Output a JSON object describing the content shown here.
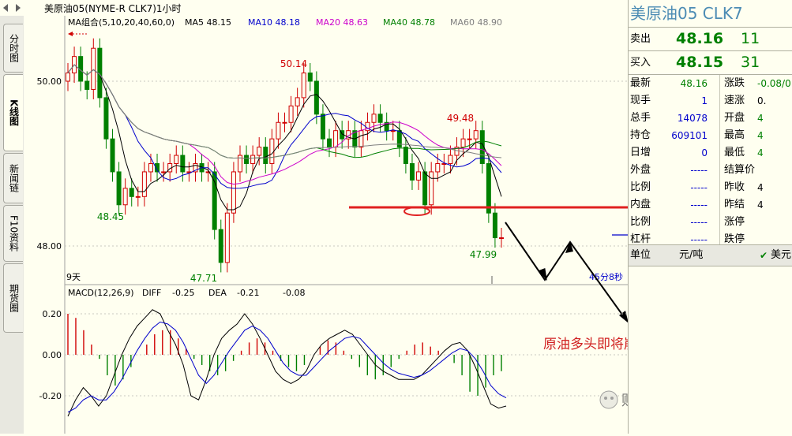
{
  "window": {
    "title": "美原油05(NYME-R CLK7)1小时"
  },
  "side_tabs": [
    {
      "label": "分时图"
    },
    {
      "label": "K线图"
    },
    {
      "label": "新闻链"
    },
    {
      "label": "F10资料"
    },
    {
      "label": "期货圈"
    }
  ],
  "ma_legend": {
    "group": "MA组合(5,10,20,40,60,0)",
    "items": [
      {
        "label": "MA5 48.15",
        "color": "#000000"
      },
      {
        "label": "MA10 48.18",
        "color": "#0000cc"
      },
      {
        "label": "MA20 48.63",
        "color": "#cc00cc"
      },
      {
        "label": "MA40 48.78",
        "color": "#008000"
      },
      {
        "label": "MA60 48.90",
        "color": "#808080"
      }
    ]
  },
  "price_annotations": {
    "high1": "50.14",
    "high2": "49.48",
    "low1": "48.45",
    "low2": "47.71",
    "low3": "47.99"
  },
  "time_labels": {
    "left": "9天",
    "right": "45分8秒"
  },
  "macd_legend": {
    "name": "MACD(12,26,9)",
    "diff_label": "DIFF",
    "diff": "-0.25",
    "dea_label": "DEA",
    "dea": "-0.21",
    "macd": "-0.08"
  },
  "annotation_text": "原油多头即将崩溃",
  "watermark": "财经生活参考",
  "colors": {
    "up": "#d00000",
    "down": "#008000",
    "bg": "#fffff0",
    "support_line": "#e02020"
  },
  "chart_data": [
    {
      "type": "candlestick",
      "title": "美原油05(NYME-R CLK7)1小时",
      "ylim": [
        47.5,
        50.5
      ],
      "y_ticks": [
        48.0,
        50.0
      ],
      "y_tick_labels": [
        "48.00",
        "50.00"
      ],
      "close": [
        50.1,
        50.3,
        50.0,
        49.9,
        50.4,
        49.8,
        49.3,
        48.9,
        48.5,
        48.7,
        48.6,
        48.6,
        48.9,
        49.0,
        48.9,
        48.9,
        49.0,
        49.1,
        48.9,
        48.9,
        49.0,
        48.9,
        48.9,
        48.2,
        47.8,
        48.4,
        48.9,
        49.1,
        49.0,
        49.1,
        49.2,
        49.0,
        49.3,
        49.5,
        49.5,
        49.7,
        49.8,
        50.1,
        50.0,
        49.6,
        49.3,
        49.2,
        49.4,
        49.3,
        49.4,
        49.2,
        49.4,
        49.5,
        49.6,
        49.5,
        49.4,
        49.4,
        49.2,
        49.0,
        48.8,
        48.9,
        48.5,
        48.9,
        49.0,
        49.0,
        49.1,
        49.2,
        49.3,
        49.3,
        49.4,
        49.0,
        48.4,
        48.1,
        48.1
      ],
      "support_level": 48.5,
      "annotations": [
        "50.14",
        "49.48",
        "48.45",
        "47.71",
        "47.99"
      ]
    },
    {
      "type": "bar+line",
      "name": "MACD(12,26,9)",
      "ylim": [
        -0.27,
        0.27
      ],
      "y_ticks": [
        0.2,
        0.0,
        -0.2
      ],
      "y_tick_labels": [
        "0.20",
        "0.00",
        "-0.20"
      ],
      "macd": [
        0.2,
        0.18,
        0.12,
        0.05,
        -0.02,
        -0.1,
        -0.15,
        -0.12,
        -0.06,
        0.0,
        0.05,
        0.1,
        0.12,
        0.12,
        0.08,
        0.03,
        -0.02,
        -0.05,
        -0.08,
        -0.1,
        -0.08,
        -0.03,
        0.02,
        0.06,
        0.08,
        0.06,
        0.02,
        -0.03,
        -0.06,
        -0.08,
        -0.05,
        0.0,
        0.04,
        0.07,
        0.06,
        0.02,
        -0.02,
        -0.06,
        -0.1,
        -0.12,
        -0.1,
        -0.06,
        -0.02,
        0.02,
        0.05,
        0.06,
        0.04,
        0.02,
        0.0,
        -0.04,
        -0.1,
        -0.18,
        -0.2,
        -0.16,
        -0.1,
        -0.08
      ],
      "diff": [
        -0.3,
        -0.22,
        -0.16,
        -0.2,
        -0.25,
        -0.2,
        -0.1,
        0.0,
        0.08,
        0.14,
        0.18,
        0.22,
        0.2,
        0.12,
        0.05,
        -0.05,
        -0.2,
        -0.22,
        -0.12,
        0.0,
        0.08,
        0.12,
        0.15,
        0.2,
        0.15,
        0.08,
        0.0,
        -0.08,
        -0.12,
        -0.14,
        -0.12,
        -0.08,
        0.0,
        0.05,
        0.08,
        0.1,
        0.12,
        0.1,
        0.05,
        0.0,
        -0.05,
        -0.08,
        -0.1,
        -0.12,
        -0.12,
        -0.12,
        -0.1,
        -0.06,
        -0.02,
        0.02,
        0.05,
        0.06,
        0.02,
        -0.06,
        -0.15,
        -0.24,
        -0.26,
        -0.25
      ],
      "dea": [
        -0.28,
        -0.26,
        -0.22,
        -0.2,
        -0.22,
        -0.22,
        -0.18,
        -0.12,
        -0.05,
        0.02,
        0.08,
        0.13,
        0.16,
        0.15,
        0.12,
        0.06,
        -0.02,
        -0.1,
        -0.14,
        -0.1,
        -0.04,
        0.02,
        0.07,
        0.12,
        0.14,
        0.12,
        0.08,
        0.02,
        -0.04,
        -0.08,
        -0.1,
        -0.1,
        -0.06,
        -0.02,
        0.02,
        0.05,
        0.08,
        0.09,
        0.08,
        0.04,
        0.0,
        -0.04,
        -0.07,
        -0.09,
        -0.1,
        -0.11,
        -0.1,
        -0.08,
        -0.05,
        -0.02,
        0.01,
        0.03,
        0.02,
        -0.02,
        -0.08,
        -0.15,
        -0.19,
        -0.21
      ]
    }
  ],
  "panel": {
    "title": "美原油05  CLK7",
    "ask": {
      "label": "卖出",
      "price": "48.16",
      "vol": "11"
    },
    "bid": {
      "label": "买入",
      "price": "48.15",
      "vol": "31"
    },
    "stats": [
      {
        "l": "最新",
        "v": "48.16",
        "c": "#008000",
        "l2": "涨跌",
        "v2": "-0.08/0.",
        "c2": "#008000"
      },
      {
        "l": "现手",
        "v": "1",
        "c": "#0000cc",
        "l2": "速涨",
        "v2": "0.",
        "c2": "#000000"
      },
      {
        "l": "总手",
        "v": "14078",
        "c": "#0000cc",
        "l2": "开盘",
        "v2": "4",
        "c2": "#008000"
      },
      {
        "l": "持仓",
        "v": "609101",
        "c": "#0000cc",
        "l2": "最高",
        "v2": "4",
        "c2": "#008000"
      },
      {
        "l": "日增",
        "v": "0",
        "c": "#0000cc",
        "l2": "最低",
        "v2": "4",
        "c2": "#008000"
      },
      {
        "l": "外盘",
        "v": "-----",
        "c": "#0000cc",
        "l2": "结算价",
        "v2": "",
        "c2": "#008000"
      },
      {
        "l": "比例",
        "v": "-----",
        "c": "#0000cc",
        "l2": "昨收",
        "v2": "4",
        "c2": "#000000"
      },
      {
        "l": "内盘",
        "v": "-----",
        "c": "#0000cc",
        "l2": "昨结",
        "v2": "4",
        "c2": "#000000"
      },
      {
        "l": "比例",
        "v": "-----",
        "c": "#0000cc",
        "l2": "涨停",
        "v2": "",
        "c2": "#000000"
      },
      {
        "l": "杠杆",
        "v": "-----",
        "c": "#0000cc",
        "l2": "跌停",
        "v2": "",
        "c2": "#000000"
      }
    ],
    "unit_label": "单位",
    "unit_value": "元/吨",
    "unit_check": "美元"
  }
}
